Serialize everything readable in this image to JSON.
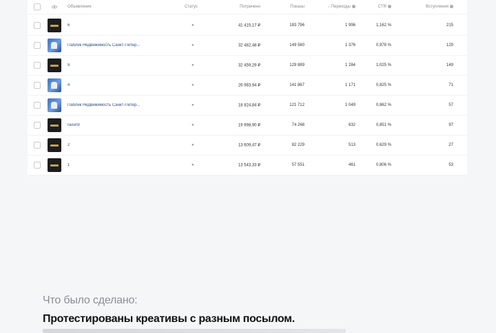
{
  "table": {
    "headers": {
      "object": "Объявление",
      "status": "Статус",
      "spend": "Потрачено",
      "impressions": "Показы",
      "clicks": "Переходы",
      "ctr": "CTR",
      "entries": "Вступления"
    },
    "rows": [
      {
        "name": "6",
        "thumb": "dark",
        "status_label": "●",
        "spend": "41 415,17 ₽",
        "impressions": "183 796",
        "clicks": "1 996",
        "ctr": "1,162 %",
        "entries": "215"
      },
      {
        "name": "Паблик Недвижимость Санкт-Петер...",
        "thumb": "blue",
        "status_label": "●",
        "spend": "32 482,48 ₽",
        "impressions": "149 580",
        "clicks": "1 376",
        "ctr": "0,978 %",
        "entries": "129"
      },
      {
        "name": "9",
        "thumb": "dark",
        "status_label": "●",
        "spend": "32 459,29 ₽",
        "impressions": "129 889",
        "clicks": "1 284",
        "ctr": "1,025 %",
        "entries": "149"
      },
      {
        "name": "4",
        "thumb": "blue",
        "status_label": "●",
        "spend": "26 983,94 ₽",
        "impressions": "141 867",
        "clicks": "1 171",
        "ctr": "0,825 %",
        "entries": "71"
      },
      {
        "name": "Паблик Недвижимость Санкт-Петер...",
        "thumb": "blue",
        "status_label": "●",
        "spend": "18 824,84 ₽",
        "impressions": "121 712",
        "clicks": "1 049",
        "ctr": "0,862 %",
        "entries": "57"
      },
      {
        "name": "raisin9",
        "thumb": "dark",
        "status_label": "●",
        "spend": "19 998,90 ₽",
        "impressions": "74 268",
        "clicks": "632",
        "ctr": "0,851 %",
        "entries": "97"
      },
      {
        "name": "2",
        "thumb": "dark",
        "status_label": "●",
        "spend": "13 609,47 ₽",
        "impressions": "82 229",
        "clicks": "513",
        "ctr": "0,629 %",
        "entries": "27"
      },
      {
        "name": "1",
        "thumb": "dark",
        "status_label": "●",
        "spend": "13 543,33 ₽",
        "impressions": "57 551",
        "clicks": "461",
        "ctr": "0,806 %",
        "entries": "53"
      }
    ]
  },
  "text": {
    "caption": "Что было сделано:",
    "line2": "Протестированы креативы с разным посылом."
  },
  "colors": {
    "background": "#f5f6f8",
    "link": "#2e4e7e",
    "muted": "#8a8e94"
  }
}
